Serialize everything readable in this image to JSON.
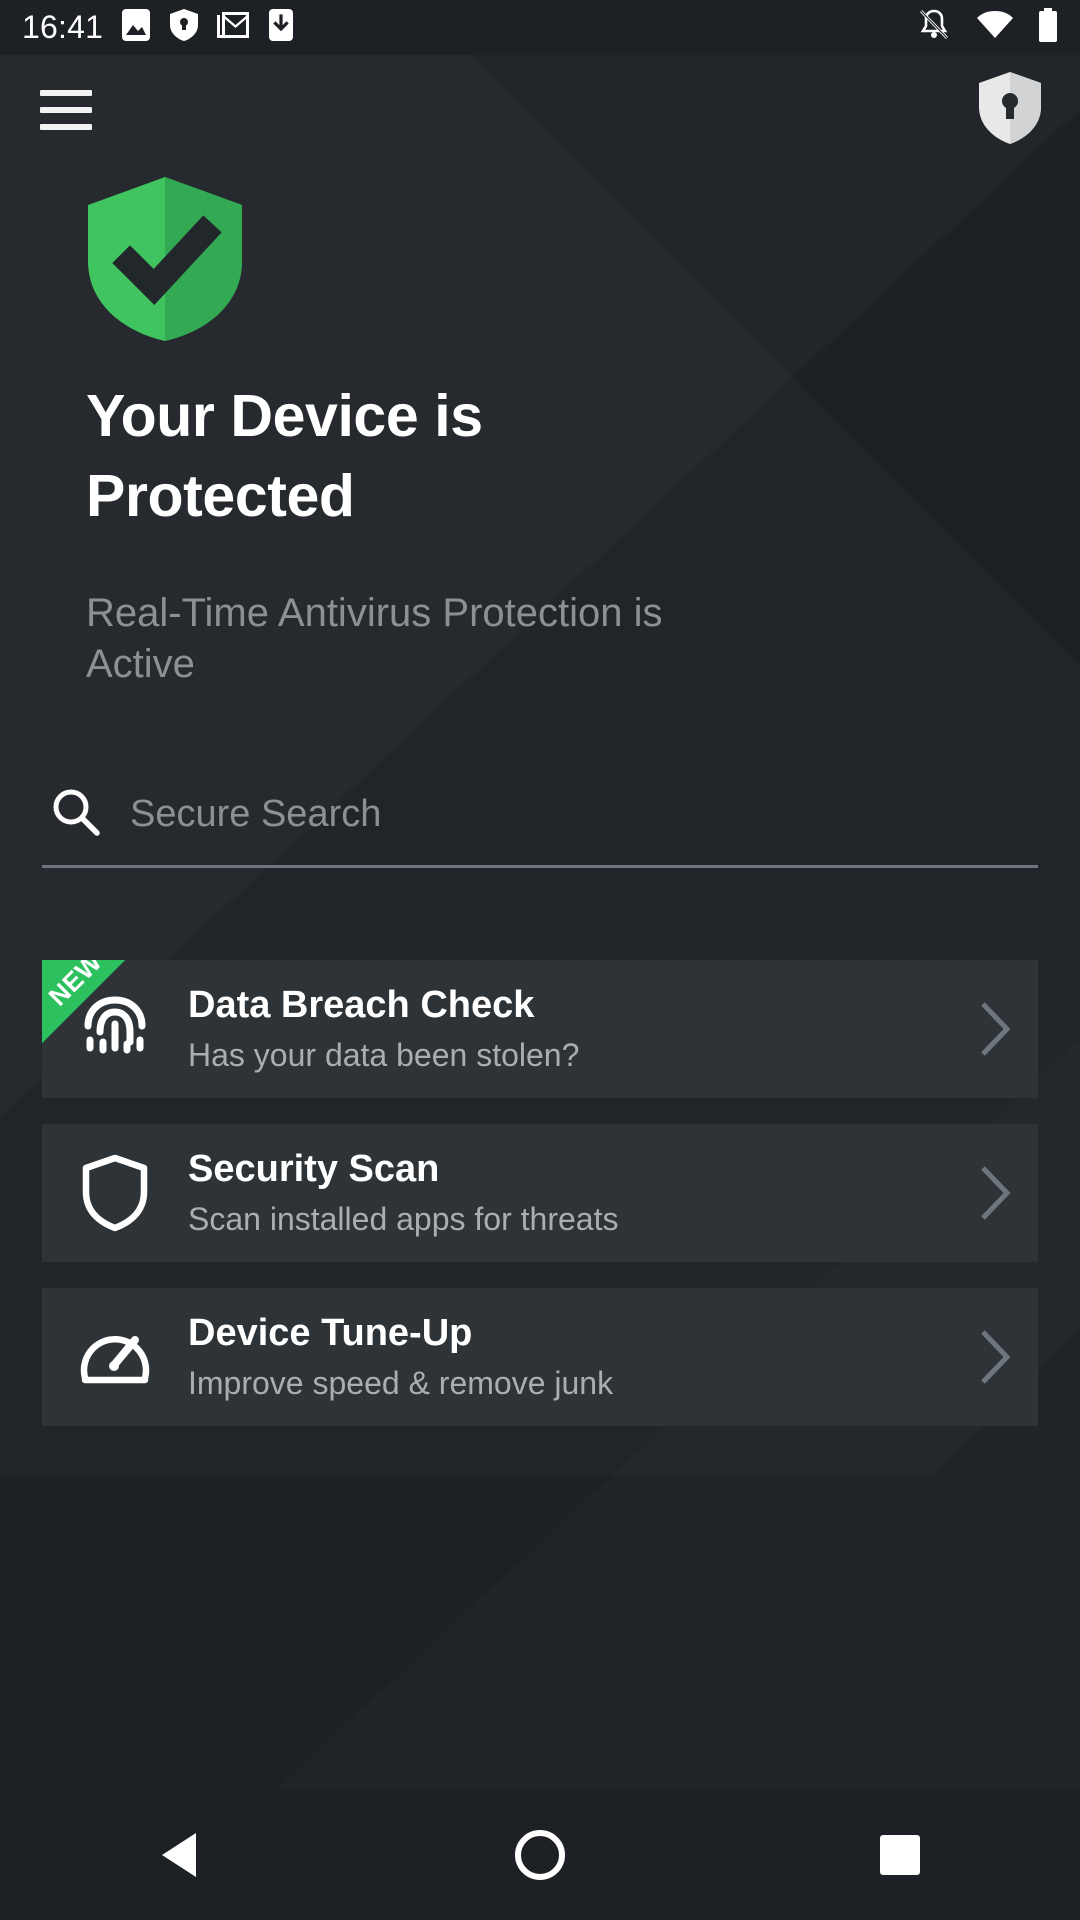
{
  "status_bar": {
    "time": "16:41",
    "left_icons": [
      "photos-icon",
      "shield-keyhole-icon",
      "gmail-icon",
      "download-icon"
    ],
    "right_icons": [
      "notifications-off-icon",
      "wifi-icon",
      "battery-icon"
    ]
  },
  "app_bar": {
    "menu_label": "menu-icon",
    "logo_label": "shield-keyhole-logo"
  },
  "hero": {
    "status_icon": "green-shield-check-icon",
    "title": "Your Device is Protected",
    "subtitle": "Real-Time Antivirus Protection is Active",
    "shield_color_light": "#3fc45f",
    "shield_color_dark": "#32a852"
  },
  "search": {
    "icon": "search-icon",
    "placeholder": "Secure Search",
    "value": ""
  },
  "cards": [
    {
      "id": "data-breach-check",
      "title": "Data Breach Check",
      "subtitle": "Has your data been stolen?",
      "icon": "fingerprint-icon",
      "badge": "NEW",
      "badge_color": "#2cc05f"
    },
    {
      "id": "security-scan",
      "title": "Security Scan",
      "subtitle": "Scan installed apps for threats",
      "icon": "shield-outline-icon",
      "badge": null
    },
    {
      "id": "device-tune-up",
      "title": "Device Tune-Up",
      "subtitle": "Improve speed & remove junk",
      "icon": "speedometer-icon",
      "badge": null
    }
  ],
  "nav_bar": {
    "back": "back-triangle-icon",
    "home": "home-circle-icon",
    "recents": "recents-square-icon"
  },
  "colors": {
    "background": "#1d2125",
    "card": "#2e3337",
    "accent_green": "#2cc05f",
    "text_primary": "#ffffff",
    "text_secondary": "#8b9095"
  }
}
